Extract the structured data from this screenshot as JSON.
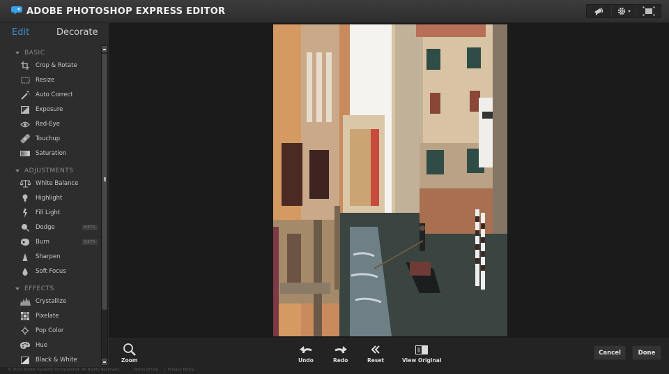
{
  "app": {
    "title": "ADOBE PHOTOSHOP EXPRESS EDITOR",
    "logo_icon": "speech-bubble-logo-icon",
    "accent_color": "#3c8ed6"
  },
  "top_tools": [
    {
      "name": "megaphone-icon",
      "label": "Announcements"
    },
    {
      "name": "gear-icon",
      "label": "Settings",
      "has_dropdown": true
    },
    {
      "name": "fullscreen-icon",
      "label": "Full screen"
    }
  ],
  "tabs": [
    {
      "label": "Edit",
      "active": true
    },
    {
      "label": "Decorate",
      "active": false
    }
  ],
  "sidebar": {
    "sections": [
      {
        "title": "BASIC",
        "items": [
          {
            "label": "Crop & Rotate",
            "icon": "crop-icon"
          },
          {
            "label": "Resize",
            "icon": "resize-icon"
          },
          {
            "label": "Auto Correct",
            "icon": "magic-wand-icon"
          },
          {
            "label": "Exposure",
            "icon": "exposure-icon"
          },
          {
            "label": "Red-Eye",
            "icon": "eye-icon"
          },
          {
            "label": "Touchup",
            "icon": "bandage-icon"
          },
          {
            "label": "Saturation",
            "icon": "saturation-icon"
          }
        ]
      },
      {
        "title": "ADJUSTMENTS",
        "items": [
          {
            "label": "White Balance",
            "icon": "scales-icon"
          },
          {
            "label": "Highlight",
            "icon": "lightbulb-icon"
          },
          {
            "label": "Fill Light",
            "icon": "flash-icon"
          },
          {
            "label": "Dodge",
            "icon": "dodge-icon",
            "badge": "BETA"
          },
          {
            "label": "Burn",
            "icon": "burn-icon",
            "badge": "BETA"
          },
          {
            "label": "Sharpen",
            "icon": "sharpen-icon"
          },
          {
            "label": "Soft Focus",
            "icon": "droplet-icon"
          }
        ]
      },
      {
        "title": "EFFECTS",
        "items": [
          {
            "label": "Crystallize",
            "icon": "crystallize-icon"
          },
          {
            "label": "Pixelate",
            "icon": "pixelate-icon"
          },
          {
            "label": "Pop Color",
            "icon": "target-icon"
          },
          {
            "label": "Hue",
            "icon": "palette-icon"
          },
          {
            "label": "Black & White",
            "icon": "black-white-icon"
          }
        ]
      }
    ]
  },
  "canvas": {
    "photo_description": "Venice canal with gondola between old buildings"
  },
  "bottom_toolbar": {
    "zoom": "Zoom",
    "undo": "Undo",
    "redo": "Redo",
    "reset": "Reset",
    "view_original": "View Original",
    "cancel": "Cancel",
    "done": "Done"
  },
  "footer": {
    "copyright": "© 2013 Adobe Systems Incorporated. All Rights Reserved.",
    "terms": "Terms of Use",
    "separator": "|",
    "privacy": "Privacy Policy"
  }
}
